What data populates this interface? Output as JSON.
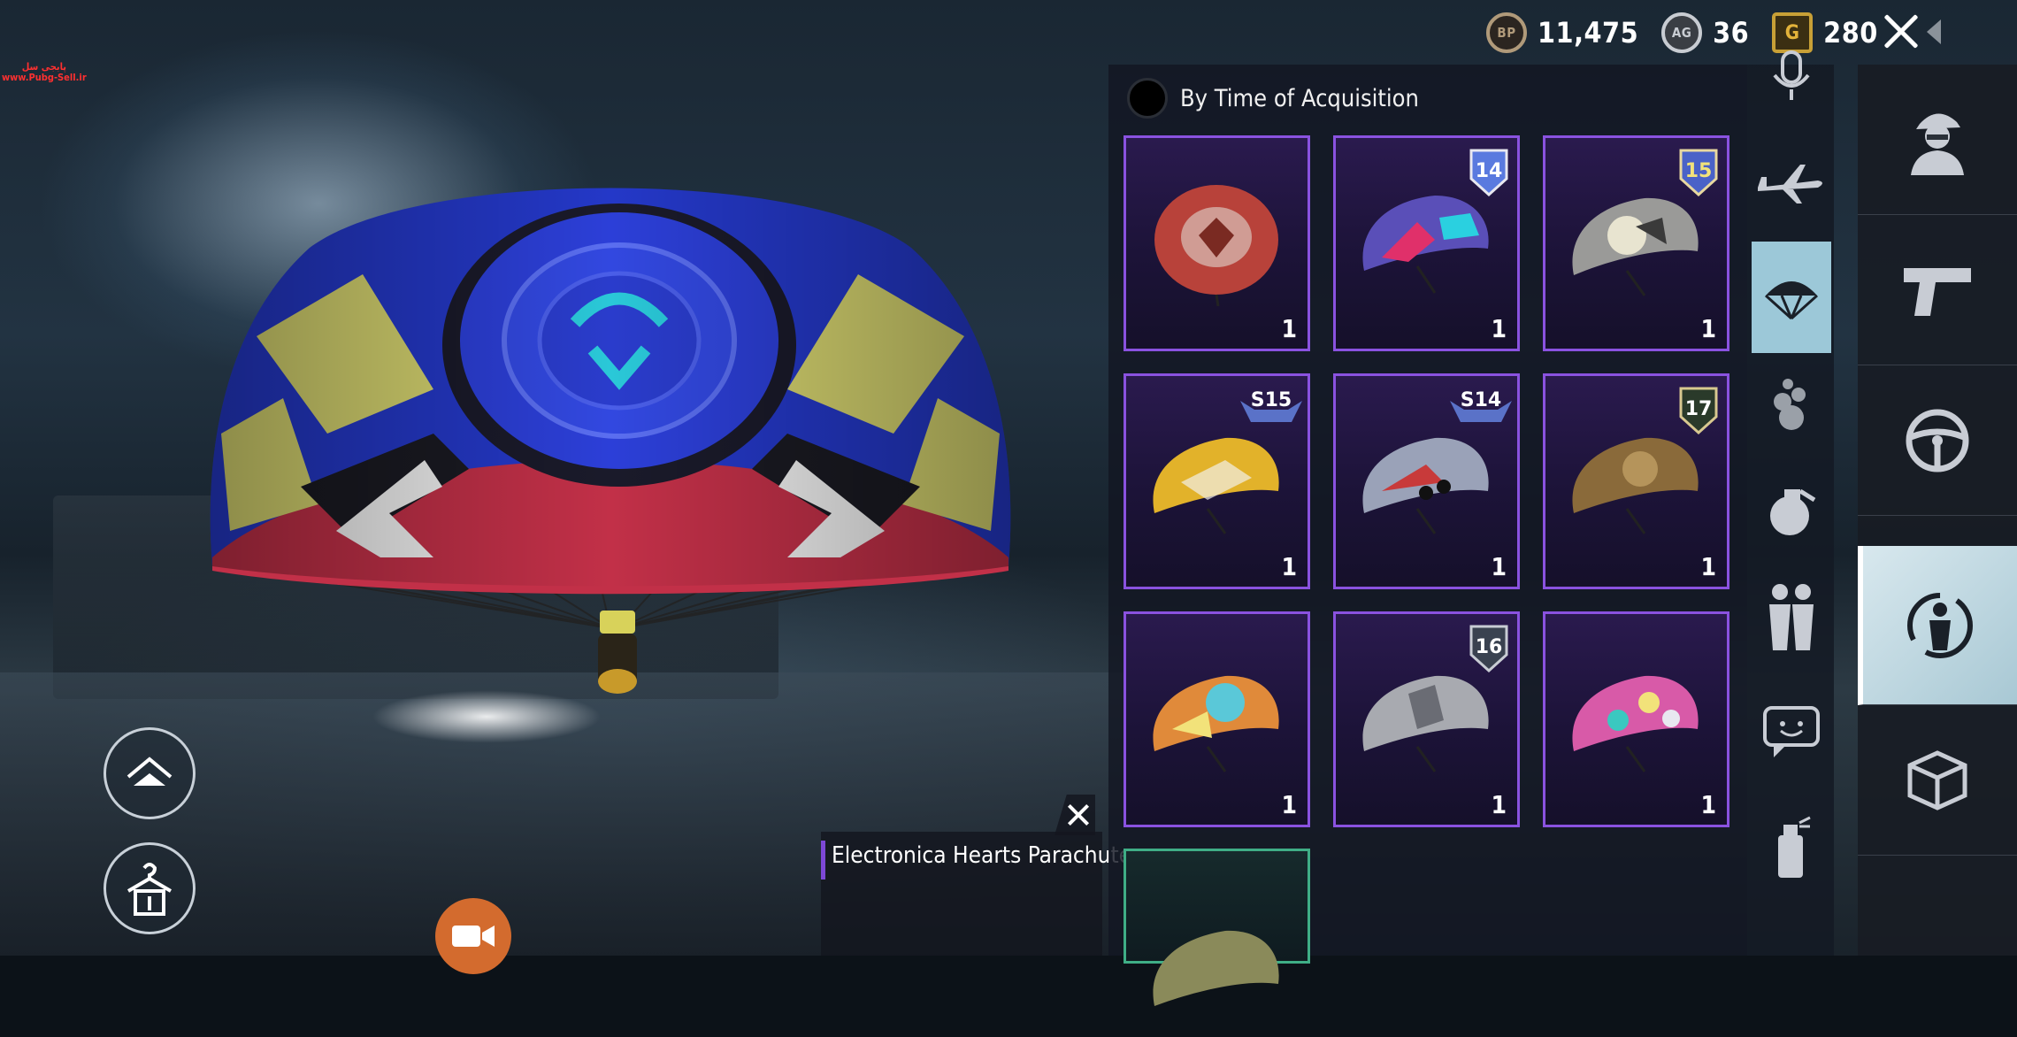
{
  "watermark": {
    "line1": "پابجی سل",
    "line2": "www.Pubg-Sell.ir"
  },
  "currency": [
    {
      "icon": "bp-coin-icon",
      "badge": "BP",
      "amount": "11,475"
    },
    {
      "icon": "ag-coin-icon",
      "badge": "AG",
      "amount": "36"
    },
    {
      "icon": "uc-coin-icon",
      "badge": "G",
      "amount": "280"
    }
  ],
  "sort": {
    "label": "By Time of Acquisition"
  },
  "items": [
    {
      "name": "red-parachute",
      "qty": "1",
      "badge": "",
      "color": "#b8423a"
    },
    {
      "name": "neon-parachute",
      "qty": "1",
      "badge": "14",
      "color": "#5a4fb8"
    },
    {
      "name": "moon-parachute",
      "qty": "1",
      "badge": "15",
      "color": "#9a9a98"
    },
    {
      "name": "yellow-parachute",
      "qty": "1",
      "badge": "S15",
      "color": "#e2b22a"
    },
    {
      "name": "graffiti-parachute",
      "qty": "1",
      "badge": "S14",
      "color": "#9aa2b8"
    },
    {
      "name": "gold-parachute",
      "qty": "1",
      "badge": "17",
      "color": "#8a6a3a"
    },
    {
      "name": "cartoon-parachute",
      "qty": "1",
      "badge": "",
      "color": "#e08a3a"
    },
    {
      "name": "silver-parachute",
      "qty": "1",
      "badge": "16",
      "color": "#a8aab0"
    },
    {
      "name": "hearts-parachute",
      "qty": "1",
      "badge": "",
      "color": "#d85aa8"
    }
  ],
  "tooltip": {
    "item_name": "Electronica Hearts Parachute"
  },
  "colors": {
    "accent": "#8a52e0",
    "active_rail": "#9cc8d8",
    "camera_button": "#d36b2e"
  }
}
